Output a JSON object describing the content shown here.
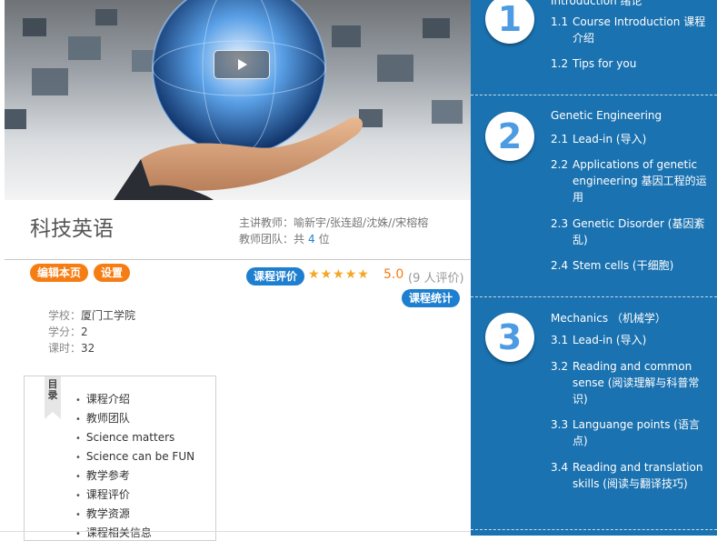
{
  "course": {
    "title": "科技英语",
    "teacher_label": "主讲教师：",
    "teachers": "喻新宇/张连超/沈姝//宋榕榕",
    "team_label": "教师团队：共",
    "team_count": "4",
    "team_unit": "位"
  },
  "actions": {
    "edit": "编辑本页",
    "settings": "设置",
    "review": "课程评价",
    "stats": "课程统计"
  },
  "rating": {
    "stars": 5,
    "score": "5.0",
    "count_text": "(9 人评价)"
  },
  "meta": {
    "school_label": "学校：",
    "school": "厦门工学院",
    "credit_label": "学分：",
    "credit": "2",
    "hours_label": "课时：",
    "hours": "32"
  },
  "toc": {
    "tag": "目录",
    "items": [
      "课程介绍",
      "教师团队",
      "Science matters",
      "Science can be FUN",
      "教学参考",
      "课程评价",
      "教学资源",
      "课程相关信息"
    ]
  },
  "units": [
    {
      "number": "1",
      "title": "Introduction 绪论",
      "lessons": [
        {
          "n": "1.1",
          "t": "Course Introduction 课程介绍"
        },
        {
          "n": "1.2",
          "t": "Tips for you"
        }
      ]
    },
    {
      "number": "2",
      "title": "Genetic Engineering",
      "lessons": [
        {
          "n": "2.1",
          "t": "Lead-in (导入)"
        },
        {
          "n": "2.2",
          "t": "Applications of genetic engineering 基因工程的运用"
        },
        {
          "n": "2.3",
          "t": "Genetic Disorder (基因紊乱)"
        },
        {
          "n": "2.4",
          "t": "Stem cells (干细胞)"
        }
      ]
    },
    {
      "number": "3",
      "title": "Mechanics （机械学）",
      "lessons": [
        {
          "n": "3.1",
          "t": "Lead-in (导入)"
        },
        {
          "n": "3.2",
          "t": "Reading and common sense (阅读理解与科普常识)"
        },
        {
          "n": "3.3",
          "t": "Languange points (语言点)"
        },
        {
          "n": "3.4",
          "t": "Reading and translation skills (阅读与翻译技巧)"
        }
      ]
    }
  ],
  "colors": {
    "sidebar": "#1b72b0",
    "accent_orange": "#f57d14",
    "accent_blue": "#1e7fd0",
    "star": "#f5a623"
  }
}
